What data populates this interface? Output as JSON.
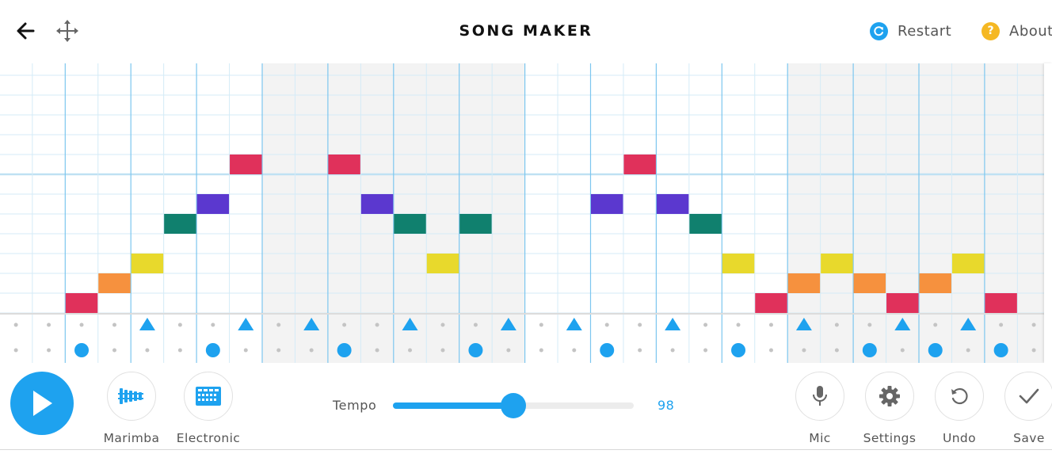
{
  "header": {
    "title": "SONG MAKER",
    "restart_label": "Restart",
    "about_label": "About",
    "about_icon_glyph": "?",
    "back_icon": "arrow-left-icon",
    "move_icon": "move-arrows-icon"
  },
  "colors": {
    "accent": "#1ea2ef",
    "about_badge": "#f5b823",
    "shaded_column": "#f3f3f3",
    "grid_line": "#d4ebf7",
    "beat_line": "#7cc6ef"
  },
  "grid": {
    "columns": 32,
    "pitch_rows": 13,
    "rhythm_rows": 2,
    "shaded_columns": [
      8,
      9,
      10,
      11,
      12,
      13,
      14,
      15,
      24,
      25,
      26,
      27,
      28,
      29,
      30,
      31
    ],
    "notes": [
      {
        "col": 2,
        "row": 12,
        "color": "#e0315b"
      },
      {
        "col": 3,
        "row": 11,
        "color": "#f6913e"
      },
      {
        "col": 4,
        "row": 10,
        "color": "#e8d92c"
      },
      {
        "col": 5,
        "row": 8,
        "color": "#10806e"
      },
      {
        "col": 6,
        "row": 7,
        "color": "#5b38cf"
      },
      {
        "col": 7,
        "row": 5,
        "color": "#e0315b"
      },
      {
        "col": 10,
        "row": 5,
        "color": "#e0315b"
      },
      {
        "col": 11,
        "row": 7,
        "color": "#5b38cf"
      },
      {
        "col": 12,
        "row": 8,
        "color": "#10806e"
      },
      {
        "col": 13,
        "row": 10,
        "color": "#e8d92c"
      },
      {
        "col": 14,
        "row": 8,
        "color": "#10806e"
      },
      {
        "col": 18,
        "row": 7,
        "color": "#5b38cf"
      },
      {
        "col": 19,
        "row": 5,
        "color": "#e0315b"
      },
      {
        "col": 20,
        "row": 7,
        "color": "#5b38cf"
      },
      {
        "col": 21,
        "row": 8,
        "color": "#10806e"
      },
      {
        "col": 22,
        "row": 10,
        "color": "#e8d92c"
      },
      {
        "col": 23,
        "row": 12,
        "color": "#e0315b"
      },
      {
        "col": 24,
        "row": 11,
        "color": "#f6913e"
      },
      {
        "col": 25,
        "row": 10,
        "color": "#e8d92c"
      },
      {
        "col": 26,
        "row": 11,
        "color": "#f6913e"
      },
      {
        "col": 27,
        "row": 12,
        "color": "#e0315b"
      },
      {
        "col": 28,
        "row": 11,
        "color": "#f6913e"
      },
      {
        "col": 29,
        "row": 10,
        "color": "#e8d92c"
      },
      {
        "col": 30,
        "row": 12,
        "color": "#e0315b"
      }
    ],
    "triangle_columns": [
      4,
      7,
      9,
      12,
      15,
      17,
      20,
      24,
      27,
      29
    ],
    "circle_columns": [
      2,
      6,
      10,
      14,
      18,
      22,
      26,
      28,
      30
    ]
  },
  "bottom": {
    "play_icon": "play-icon",
    "marimba_label": "Marimba",
    "electronic_label": "Electronic",
    "tempo_label": "Tempo",
    "tempo_value": "98",
    "tempo_fraction": 0.5,
    "mic_label": "Mic",
    "settings_label": "Settings",
    "undo_label": "Undo",
    "save_label": "Save"
  }
}
